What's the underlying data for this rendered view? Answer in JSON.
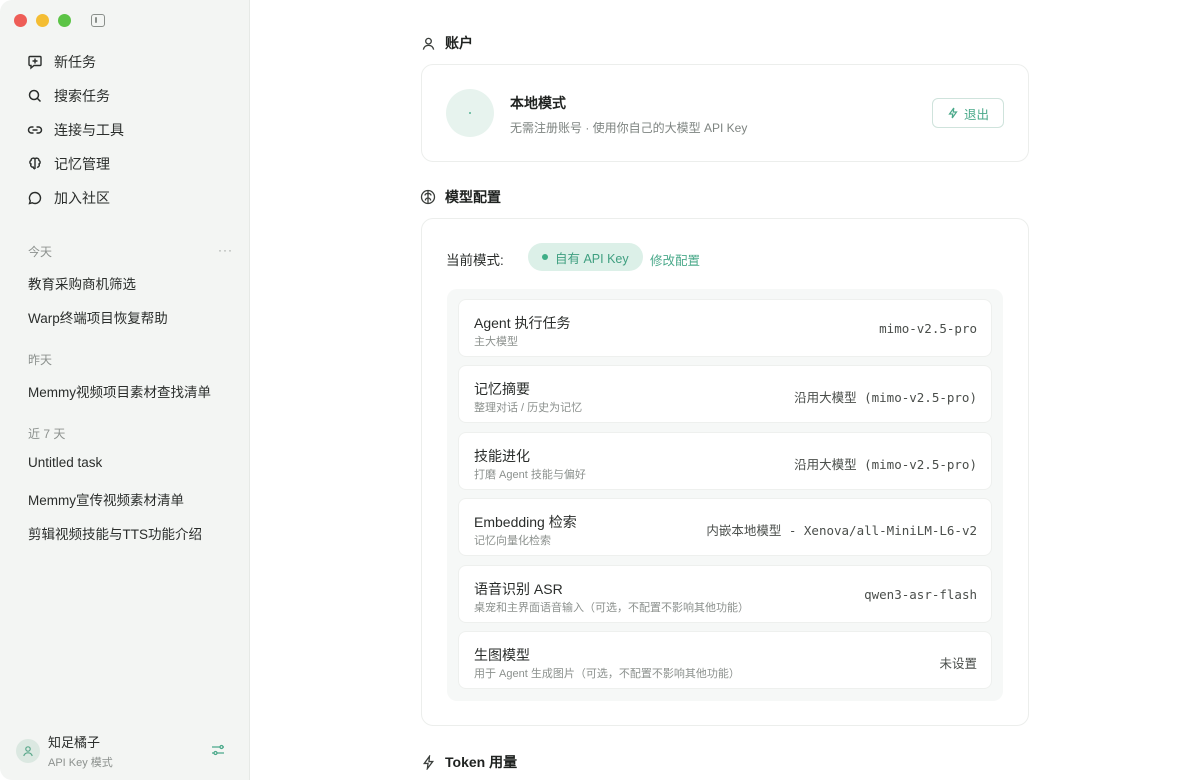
{
  "sidebar": {
    "nav": [
      {
        "label": "新任务",
        "icon": "new-task-icon"
      },
      {
        "label": "搜索任务",
        "icon": "search-icon"
      },
      {
        "label": "连接与工具",
        "icon": "link-icon"
      },
      {
        "label": "记忆管理",
        "icon": "brain-icon"
      },
      {
        "label": "加入社区",
        "icon": "chat-bubble-icon"
      }
    ],
    "groups": {
      "today": {
        "label": "今天",
        "more": "···",
        "items": [
          "教育采购商机筛选",
          "Warp终端项目恢复帮助"
        ]
      },
      "yesterday": {
        "label": "昨天",
        "items": [
          "Memmy视频项目素材查找清单"
        ]
      },
      "last7": {
        "label": "近 7 天",
        "items": [
          "Untitled task",
          "Memmy宣传视频素材清单",
          "剪辑视频技能与TTS功能介绍"
        ]
      }
    },
    "user": {
      "name": "知足橘子",
      "mode": "API Key 模式"
    }
  },
  "main": {
    "account": {
      "heading": "账户",
      "title": "本地模式",
      "subtitle": "无需注册账号 · 使用你自己的大模型 API Key",
      "logout_label": "退出"
    },
    "model": {
      "heading": "模型配置",
      "mode_label": "当前模式:",
      "mode_badge": "自有 API Key",
      "edit_label": "修改配置",
      "rows": [
        {
          "title": "Agent 执行任务",
          "sub": "主大模型",
          "value": "mimo-v2.5-pro"
        },
        {
          "title": "记忆摘要",
          "sub": "整理对话 / 历史为记忆",
          "value": "沿用大模型 (mimo-v2.5-pro)"
        },
        {
          "title": "技能进化",
          "sub": "打磨 Agent 技能与偏好",
          "value": "沿用大模型 (mimo-v2.5-pro)"
        },
        {
          "title": "Embedding 检索",
          "sub": "记忆向量化检索",
          "value": "内嵌本地模型 - Xenova/all-MiniLM-L6-v2"
        },
        {
          "title": "语音识别 ASR",
          "sub": "桌宠和主界面语音输入（可选，不配置不影响其他功能）",
          "value": "qwen3-asr-flash"
        },
        {
          "title": "生图模型",
          "sub": "用于 Agent 生成图片（可选，不配置不影响其他功能）",
          "value": "未设置"
        }
      ]
    },
    "token": {
      "heading": "Token 用量"
    }
  },
  "colors": {
    "accent": "#4aa98a",
    "badge_bg": "#dcf0e8",
    "sidebar_bg": "#f3f5f3"
  }
}
